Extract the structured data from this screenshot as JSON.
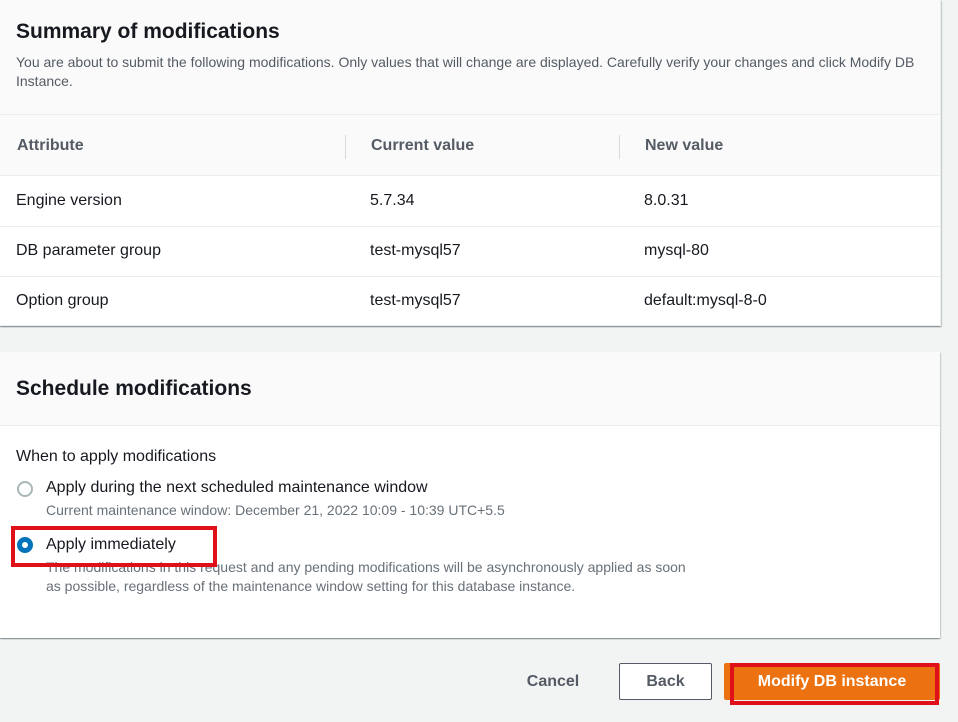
{
  "summary": {
    "title": "Summary of modifications",
    "description": "You are about to submit the following modifications. Only values that will change are displayed. Carefully verify your changes and click Modify DB Instance.",
    "columns": [
      "Attribute",
      "Current value",
      "New value"
    ],
    "rows": [
      {
        "attribute": "Engine version",
        "current": "5.7.34",
        "new": "8.0.31"
      },
      {
        "attribute": "DB parameter group",
        "current": "test-mysql57",
        "new": "mysql-80"
      },
      {
        "attribute": "Option group",
        "current": "test-mysql57",
        "new": "default:mysql-8-0"
      }
    ]
  },
  "schedule": {
    "title": "Schedule modifications",
    "when_label": "When to apply modifications",
    "options": [
      {
        "label": "Apply during the next scheduled maintenance window",
        "description": "Current maintenance window: December 21, 2022 10:09 - 10:39 UTC+5.5",
        "selected": false
      },
      {
        "label": "Apply immediately",
        "description": "The modifications in this request and any pending modifications will be asynchronously applied as soon as possible, regardless of the maintenance window setting for this database instance.",
        "selected": true
      }
    ]
  },
  "footer": {
    "cancel_label": "Cancel",
    "back_label": "Back",
    "modify_label": "Modify DB instance"
  },
  "colors": {
    "primary_button": "#ec7211",
    "radio_selected": "#0073bb",
    "highlight": "#e0101a"
  }
}
